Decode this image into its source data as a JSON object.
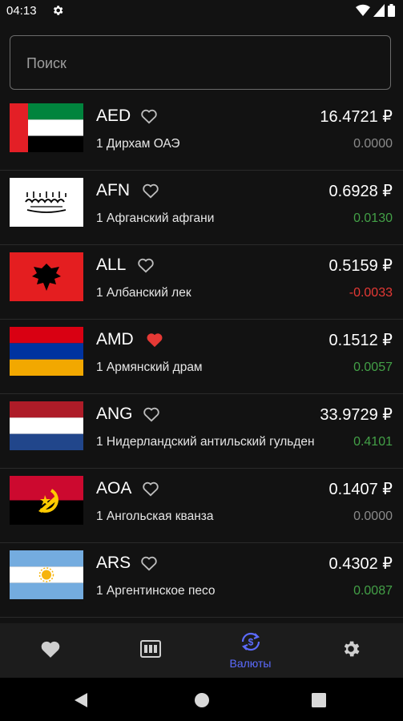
{
  "status_bar": {
    "time": "04:13",
    "icons": [
      "gear-icon",
      "wifi-icon",
      "signal-icon",
      "battery-icon"
    ]
  },
  "search": {
    "placeholder": "Поиск",
    "value": ""
  },
  "currency_symbol": "₽",
  "currencies": [
    {
      "code": "AED",
      "name": "1 Дирхам ОАЭ",
      "rate": "16.4721 ₽",
      "change": "0.0000",
      "trend": "neutral",
      "favorite": false,
      "flag": "uae-flag"
    },
    {
      "code": "AFN",
      "name": "1 Афганский афгани",
      "rate": "0.6928 ₽",
      "change": "0.0130",
      "trend": "up",
      "favorite": false,
      "flag": "afghanistan-flag"
    },
    {
      "code": "ALL",
      "name": "1 Албанский лек",
      "rate": "0.5159 ₽",
      "change": "-0.0033",
      "trend": "down",
      "favorite": false,
      "flag": "albania-flag"
    },
    {
      "code": "AMD",
      "name": "1 Армянский драм",
      "rate": "0.1512 ₽",
      "change": "0.0057",
      "trend": "up",
      "favorite": true,
      "flag": "armenia-flag"
    },
    {
      "code": "ANG",
      "name": "1 Нидерландский антильский гульден",
      "rate": "33.9729 ₽",
      "change": "0.4101",
      "trend": "up",
      "favorite": false,
      "flag": "netherlands-flag"
    },
    {
      "code": "AOA",
      "name": "1 Ангольская кванза",
      "rate": "0.1407 ₽",
      "change": "0.0000",
      "trend": "neutral",
      "favorite": false,
      "flag": "angola-flag"
    },
    {
      "code": "ARS",
      "name": "1 Аргентинское песо",
      "rate": "0.4302 ₽",
      "change": "0.0087",
      "trend": "up",
      "favorite": false,
      "flag": "argentina-flag"
    }
  ],
  "colors": {
    "up": "#43a047",
    "down": "#e53935",
    "neutral": "#8a8a8a",
    "accent": "#5c6bff",
    "favorite": "#e53935"
  },
  "bottom_nav": {
    "items": [
      {
        "icon": "heart-icon",
        "label": ""
      },
      {
        "icon": "calculator-icon",
        "label": ""
      },
      {
        "icon": "currency-exchange-icon",
        "label": "Валюты",
        "active": true
      },
      {
        "icon": "settings-icon",
        "label": ""
      }
    ]
  },
  "system_nav": [
    "back-icon",
    "home-icon",
    "recents-icon"
  ]
}
